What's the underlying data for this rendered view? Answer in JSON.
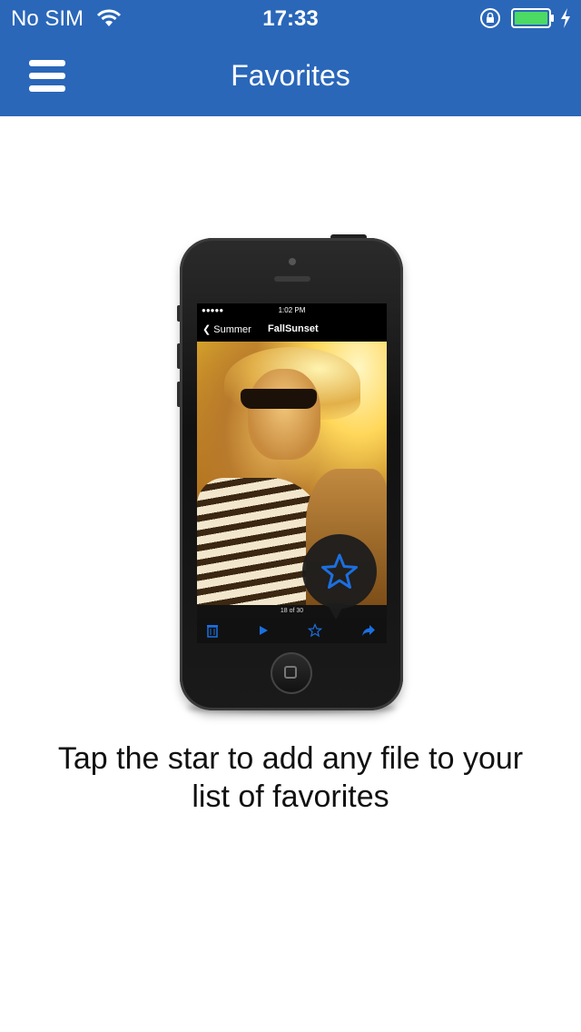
{
  "status_bar": {
    "carrier": "No SIM",
    "time": "17:33"
  },
  "nav": {
    "title": "Favorites"
  },
  "illustration": {
    "inner_status_time": "1:02 PM",
    "inner_back_label": "Summer",
    "inner_title": "FallSunset",
    "inner_counter": "18 of 30"
  },
  "caption": {
    "line1": "Tap the star to add any file to your",
    "line2": "list of favorites"
  },
  "colors": {
    "brand_blue": "#2a67b9",
    "star_blue": "#1c6fe0"
  },
  "icons": [
    "wifi-icon",
    "rotation-lock-icon",
    "battery-icon",
    "charging-bolt-icon",
    "menu-icon",
    "star-icon",
    "trash-icon",
    "play-icon",
    "share-icon"
  ]
}
